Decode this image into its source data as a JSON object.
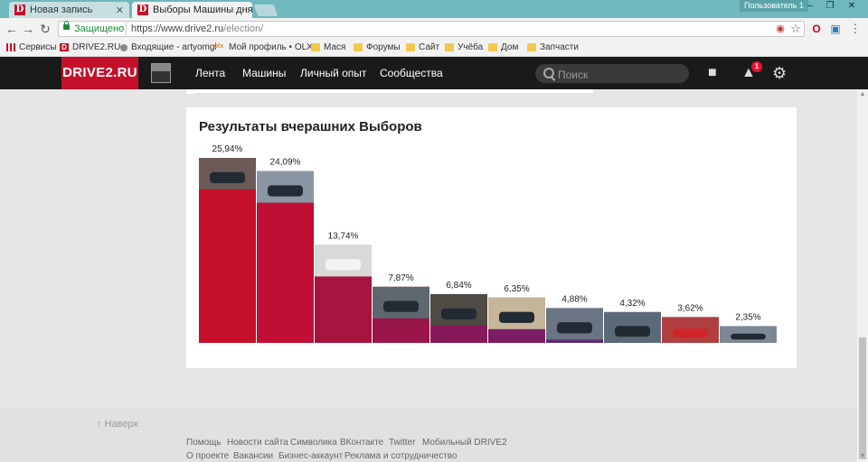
{
  "browser": {
    "tabs": [
      {
        "title": "Новая запись",
        "favicon": "D",
        "active": false
      },
      {
        "title": "Выборы Машины дня",
        "favicon": "D",
        "active": true
      }
    ],
    "close_glyph": "✕",
    "profile_label": "Пользователь 1",
    "secure_label": "Защищено",
    "url_host": "https://www.drive2.ru",
    "url_path": "/election/"
  },
  "bookmarks": [
    {
      "label": "Сервисы",
      "icon": "apps-grid-icon"
    },
    {
      "label": "DRIVE2.RU",
      "icon": "drive2-favicon"
    },
    {
      "label": "Входящие - artyomgl",
      "icon": "mail-icon"
    },
    {
      "label": "Мой профиль • OLX",
      "icon": "olx-icon"
    },
    {
      "label": "Мася",
      "icon": "folder-icon"
    },
    {
      "label": "Форумы",
      "icon": "folder-icon"
    },
    {
      "label": "Сайт",
      "icon": "folder-icon"
    },
    {
      "label": "Учёба",
      "icon": "folder-icon"
    },
    {
      "label": "Дом",
      "icon": "folder-icon"
    },
    {
      "label": "Запчасти",
      "icon": "folder-icon"
    }
  ],
  "site": {
    "logo": "DRIVE2.RU",
    "nav": [
      "Лента",
      "Машины",
      "Личный опыт",
      "Сообщества"
    ],
    "search_placeholder": "Поиск",
    "notifications_count": "1"
  },
  "election": {
    "title": "Результаты вчерашних Выборов"
  },
  "chart_data": {
    "type": "bar",
    "title": "Результаты вчерашних Выборов",
    "value_labels": [
      "25,94%",
      "24,09%",
      "13,74%",
      "7,87%",
      "6,84%",
      "6,35%",
      "4,88%",
      "4,32%",
      "3,62%",
      "2,35%"
    ],
    "values": [
      25.94,
      24.09,
      13.74,
      7.87,
      6.84,
      6.35,
      4.88,
      4.32,
      3.62,
      2.35
    ],
    "colors": [
      "#c5102b",
      "#c10e34",
      "#a8123f",
      "#9a1548",
      "#86195a",
      "#7a1d64",
      "#5e2a70",
      "#4d2e72",
      "#3a3f84",
      "#2d4a90"
    ],
    "ylim": [
      0,
      25.94
    ]
  },
  "footer": {
    "to_top": "Наверх",
    "links_row1": [
      "Помощь",
      "Новости сайта",
      "Символика",
      "ВКонтакте",
      "Twitter",
      "Мобильный DRIVE2"
    ],
    "links_row2": [
      "О проекте",
      "Вакансии",
      "Бизнес-аккаунт",
      "Реклама и сотрудничество"
    ]
  }
}
